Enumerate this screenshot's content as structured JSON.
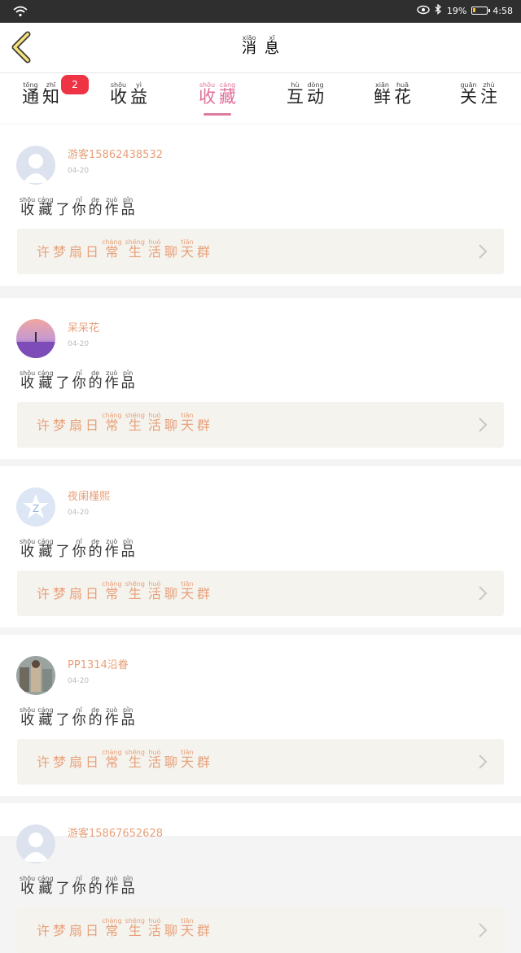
{
  "status_bar": {
    "battery_level": "19%",
    "battery_fraction": 0.19,
    "time": "4:58",
    "icons": [
      "wifi-icon",
      "eye-icon",
      "bluetooth-icon",
      "battery-icon"
    ]
  },
  "header": {
    "title": {
      "py": [
        "xiāo",
        "xī"
      ],
      "ch": [
        "消",
        "息"
      ]
    }
  },
  "tabs": [
    {
      "py": [
        "tōng",
        "zhī"
      ],
      "ch": [
        "通",
        "知"
      ],
      "badge": "2"
    },
    {
      "py": [
        "shōu",
        "yì"
      ],
      "ch": [
        "收",
        "益"
      ]
    },
    {
      "py": [
        "shōu",
        "cáng"
      ],
      "ch": [
        "收",
        "藏"
      ],
      "active": true
    },
    {
      "py": [
        "hù",
        "dòng"
      ],
      "ch": [
        "互",
        "动"
      ]
    },
    {
      "py": [
        "xiān",
        "huā"
      ],
      "ch": [
        "鲜",
        "花"
      ]
    },
    {
      "py": [
        "guān",
        "zhù"
      ],
      "ch": [
        "关",
        "注"
      ]
    }
  ],
  "common": {
    "action": {
      "py": [
        "shōu",
        "cáng",
        "",
        "nǐ",
        "de",
        "zuò",
        "pǐn"
      ],
      "ch": [
        "收",
        "藏",
        "了",
        "你",
        "的",
        "作",
        "品"
      ]
    },
    "work_title": {
      "py": [
        "",
        "",
        "",
        "",
        "cháng",
        "shēng",
        "huó",
        "",
        "tiān",
        ""
      ],
      "ch": [
        "许",
        "梦",
        "扇",
        "日",
        "常",
        "生",
        "活",
        "聊",
        "天",
        "群"
      ]
    }
  },
  "items": [
    {
      "username": "游客15862438532",
      "date": "04-20",
      "avatar": "default"
    },
    {
      "username": "呆呆花",
      "date": "04-20",
      "avatar": "lavender"
    },
    {
      "username": "夜阑槿熙",
      "date": "04-20",
      "avatar": "qq"
    },
    {
      "username": "PP1314沿眷",
      "date": "04-20",
      "avatar": "group"
    },
    {
      "username": "游客15867652628",
      "date": "",
      "avatar": "default"
    }
  ],
  "colors": {
    "accent_pink": "#e0709a",
    "orange_text": "#e8a07a",
    "badge_red": "#ee3344",
    "back_arrow_fill": "#f5e27a"
  }
}
